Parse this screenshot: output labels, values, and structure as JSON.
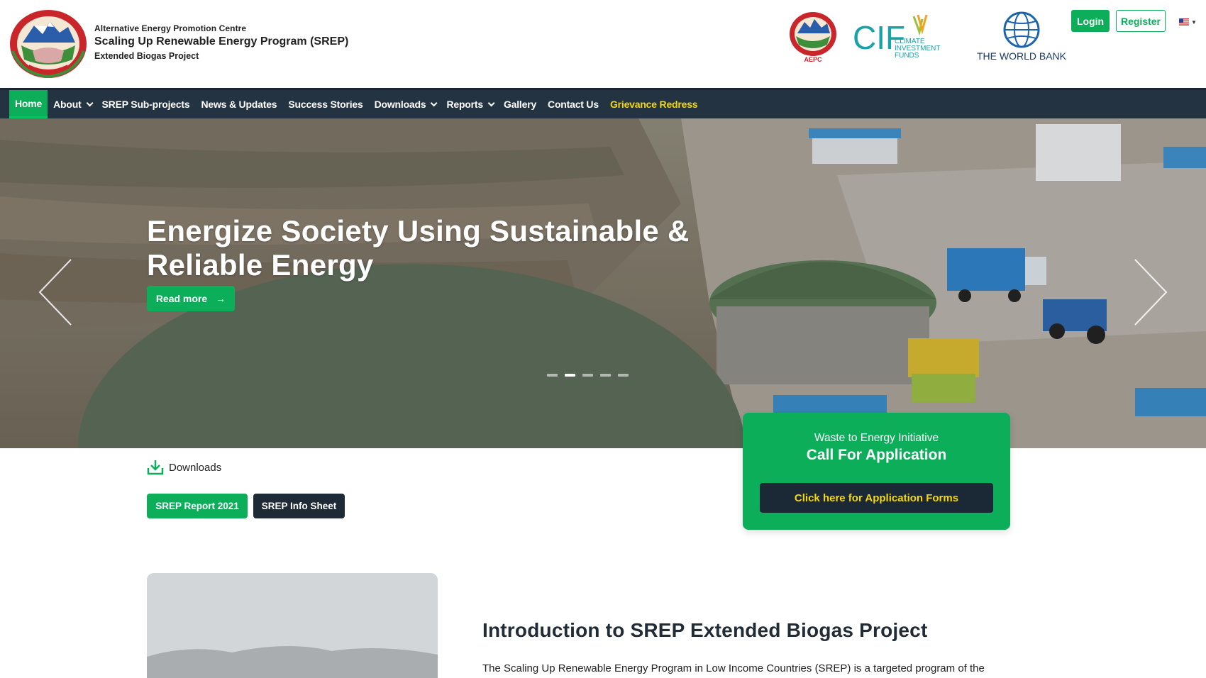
{
  "header": {
    "org_line1": "Alternative Energy Promotion Centre",
    "org_line2": "Scaling Up Renewable Energy Program (SREP)",
    "org_line3": "Extended Biogas Project",
    "partners": {
      "aepc_label": "AEPC",
      "cif_short": "CIF",
      "cif_line1": "CLIMATE",
      "cif_line2": "INVESTMENT",
      "cif_line3": "FUNDS",
      "worldbank": "THE WORLD BANK"
    },
    "login_label": "Login",
    "register_label": "Register",
    "language_icon": "us-flag-icon"
  },
  "nav": {
    "items": [
      {
        "label": "Home",
        "active": true
      },
      {
        "label": "About",
        "dropdown": true
      },
      {
        "label": "SREP Sub-projects"
      },
      {
        "label": "News & Updates"
      },
      {
        "label": "Success Stories"
      },
      {
        "label": "Downloads",
        "dropdown": true
      },
      {
        "label": "Reports",
        "dropdown": true
      },
      {
        "label": "Gallery"
      },
      {
        "label": "Contact Us"
      },
      {
        "label": "Grievance Redress",
        "highlight": true
      }
    ]
  },
  "hero": {
    "title": "Energize Society Using Sustainable & Reliable Energy",
    "read_more_label": "Read more",
    "slides_total": 5,
    "active_slide": 2
  },
  "downloads": {
    "label": "Downloads",
    "report_button": "SREP Report 2021",
    "info_button": "SREP Info Sheet"
  },
  "call_for_application": {
    "subtitle": "Waste to Energy Initiative",
    "title": "Call For Application",
    "button_label": "Click here for Application Forms"
  },
  "intro": {
    "title": "Introduction to SREP Extended Biogas Project",
    "text": "The Scaling Up Renewable Energy Program in Low Income Countries (SREP) is a targeted program of the"
  },
  "colors": {
    "accent_green": "#0cae5a",
    "nav_dark": "#243342",
    "highlight_yellow": "#f5d90a"
  }
}
